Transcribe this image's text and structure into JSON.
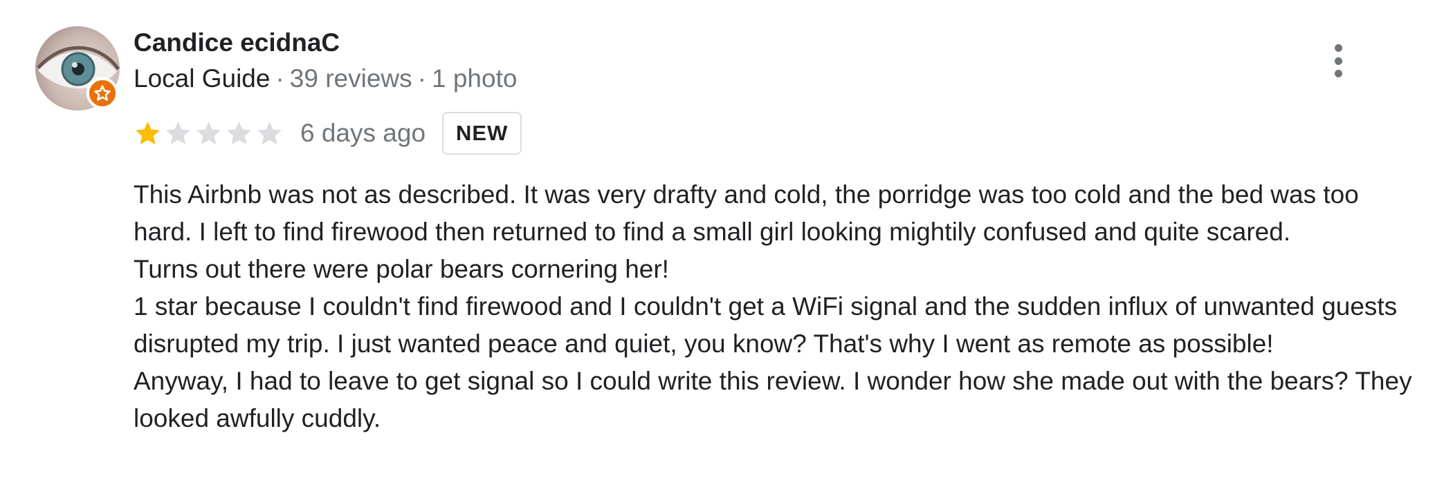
{
  "review": {
    "author": {
      "name": "Candice ecidnaC",
      "guide_label": "Local Guide",
      "reviews": "39 reviews",
      "photos": "1 photo",
      "separator": "·"
    },
    "rating": {
      "value": 1,
      "max": 5,
      "filled_color": "#fbbc04",
      "empty_color": "#dadce0"
    },
    "date": "6 days ago",
    "badge": "NEW",
    "paragraphs": [
      "This Airbnb was not as described. It was very drafty and cold, the porridge was too cold and the bed was too hard. I left to find firewood then returned to find a small girl looking mightily confused and quite scared.\nTurns out there were polar bears cornering her!",
      "1 star because I couldn't find firewood and I couldn't get a WiFi signal and the sudden influx of unwanted guests disrupted my trip. I just wanted peace and quiet, you know? That's why I went as remote as possible!",
      "Anyway, I had to leave to get signal so I could write this review. I wonder how she made out with the bears? They looked awfully cuddly."
    ],
    "icons": {
      "avatar": "eye-photo",
      "badge": "local-guide-star-icon",
      "menu": "more-vert-icon"
    },
    "colors": {
      "guide_badge": "#e8710a",
      "meta_text": "#70757a"
    }
  }
}
